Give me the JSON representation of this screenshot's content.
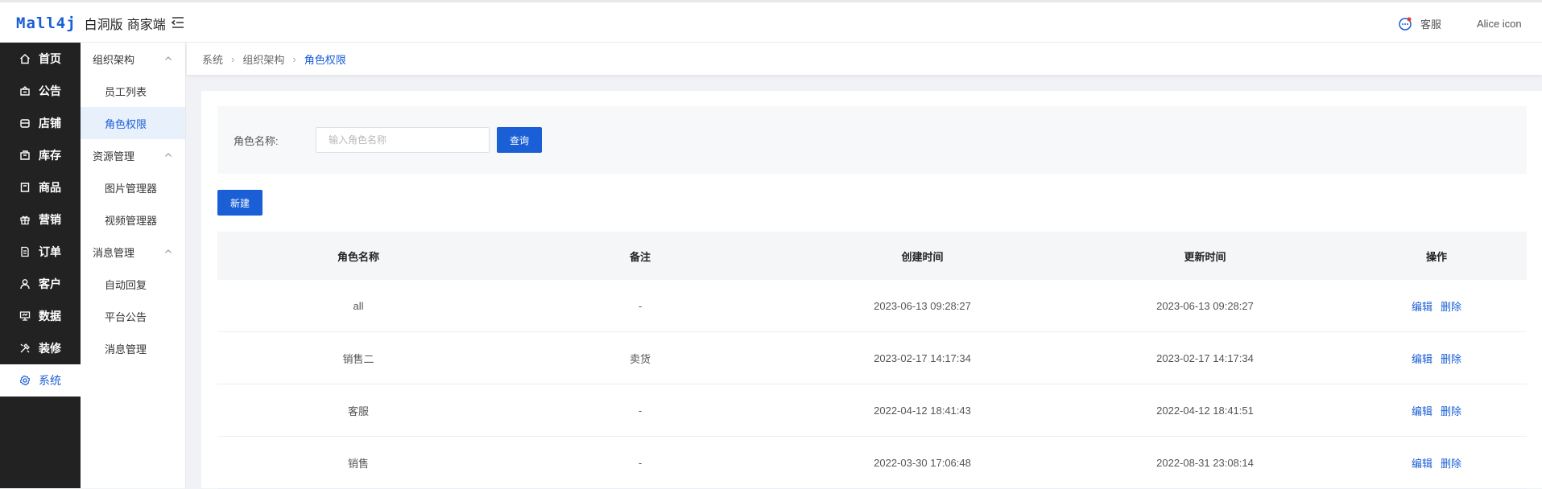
{
  "header": {
    "logo_main": "Mall4j",
    "logo_sub": "白洞版 商家端",
    "service_label": "客服",
    "user_label": "Alice icon"
  },
  "mainnav": {
    "items": [
      {
        "label": "首页",
        "icon": "home-icon"
      },
      {
        "label": "公告",
        "icon": "notice-icon"
      },
      {
        "label": "店铺",
        "icon": "shop-icon"
      },
      {
        "label": "库存",
        "icon": "inventory-icon"
      },
      {
        "label": "商品",
        "icon": "product-icon"
      },
      {
        "label": "营销",
        "icon": "gift-icon"
      },
      {
        "label": "订单",
        "icon": "order-icon"
      },
      {
        "label": "客户",
        "icon": "customer-icon"
      },
      {
        "label": "数据",
        "icon": "data-icon"
      },
      {
        "label": "装修",
        "icon": "decorate-icon"
      },
      {
        "label": "系统",
        "icon": "gear-icon"
      }
    ]
  },
  "subnav": {
    "group1": "组织架构",
    "g1_items": [
      "员工列表",
      "角色权限"
    ],
    "group2": "资源管理",
    "g2_items": [
      "图片管理器",
      "视频管理器"
    ],
    "group3": "消息管理",
    "g3_items": [
      "自动回复",
      "平台公告",
      "消息管理"
    ]
  },
  "breadcrumb": [
    "系统",
    "组织架构",
    "角色权限"
  ],
  "search": {
    "label": "角色名称:",
    "placeholder": "输入角色名称",
    "button": "查询"
  },
  "new_button": "新建",
  "table": {
    "columns": [
      "角色名称",
      "备注",
      "创建时间",
      "更新时间",
      "操作"
    ],
    "rows": [
      {
        "name": "all",
        "note": "-",
        "created": "2023-06-13 09:28:27",
        "updated": "2023-06-13 09:28:27"
      },
      {
        "name": "销售二",
        "note": "卖货",
        "created": "2023-02-17 14:17:34",
        "updated": "2023-02-17 14:17:34"
      },
      {
        "name": "客服",
        "note": "-",
        "created": "2022-04-12 18:41:43",
        "updated": "2022-04-12 18:41:51"
      },
      {
        "name": "销售",
        "note": "-",
        "created": "2022-03-30 17:06:48",
        "updated": "2022-08-31 23:08:14"
      }
    ],
    "edit_label": "编辑",
    "delete_label": "删除"
  },
  "colors": {
    "accent": "#1a5fd6",
    "nav_bg": "#222222"
  }
}
